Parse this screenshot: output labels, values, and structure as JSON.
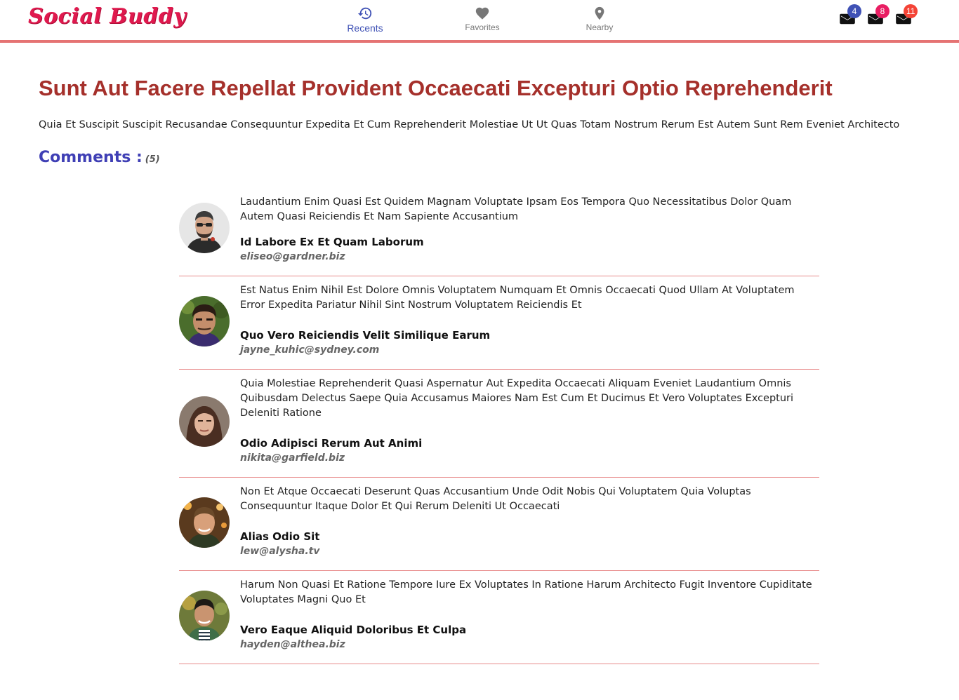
{
  "header": {
    "brand": "Social Buddy",
    "nav": [
      {
        "label": "Recents",
        "icon": "history-icon",
        "active": true
      },
      {
        "label": "Favorites",
        "icon": "heart-icon",
        "active": false
      },
      {
        "label": "Nearby",
        "icon": "location-pin-icon",
        "active": false
      }
    ],
    "notifications": [
      {
        "icon": "mail-icon",
        "count": "4",
        "color": "#3f51b5"
      },
      {
        "icon": "mail-icon",
        "count": "8",
        "color": "#e91e63"
      },
      {
        "icon": "mail-icon",
        "count": "11",
        "color": "#f44336"
      }
    ]
  },
  "post": {
    "title": "Sunt Aut Facere Repellat Provident Occaecati Excepturi Optio Reprehenderit",
    "body": "Quia Et Suscipit Suscipit Recusandae Consequuntur Expedita Et Cum Reprehenderit Molestiae Ut Ut Quas Totam Nostrum Rerum Est Autem Sunt Rem Eveniet Architecto"
  },
  "comments_section": {
    "heading": "Comments :",
    "count": "(5)"
  },
  "comments": [
    {
      "text": "Laudantium Enim Quasi Est Quidem Magnam Voluptate Ipsam Eos Tempora Quo Necessitatibus Dolor Quam Autem Quasi Reiciendis Et Nam Sapiente Accusantium",
      "name": "Id Labore Ex Et Quam Laborum",
      "email": "eliseo@gardner.biz"
    },
    {
      "text": "Est Natus Enim Nihil Est Dolore Omnis Voluptatem Numquam Et Omnis Occaecati Quod Ullam At Voluptatem Error Expedita Pariatur Nihil Sint Nostrum Voluptatem Reiciendis Et",
      "name": "Quo Vero Reiciendis Velit Similique Earum",
      "email": "jayne_kuhic@sydney.com"
    },
    {
      "text": "Quia Molestiae Reprehenderit Quasi Aspernatur Aut Expedita Occaecati Aliquam Eveniet Laudantium Omnis Quibusdam Delectus Saepe Quia Accusamus Maiores Nam Est Cum Et Ducimus Et Vero Voluptates Excepturi Deleniti Ratione",
      "name": "Odio Adipisci Rerum Aut Animi",
      "email": "nikita@garfield.biz"
    },
    {
      "text": "Non Et Atque Occaecati Deserunt Quas Accusantium Unde Odit Nobis Qui Voluptatem Quia Voluptas Consequuntur Itaque Dolor Et Qui Rerum Deleniti Ut Occaecati",
      "name": "Alias Odio Sit",
      "email": "lew@alysha.tv"
    },
    {
      "text": "Harum Non Quasi Et Ratione Tempore Iure Ex Voluptates In Ratione Harum Architecto Fugit Inventore Cupiditate Voluptates Magni Quo Et",
      "name": "Vero Eaque Aliquid Doloribus Et Culpa",
      "email": "hayden@althea.biz"
    }
  ]
}
